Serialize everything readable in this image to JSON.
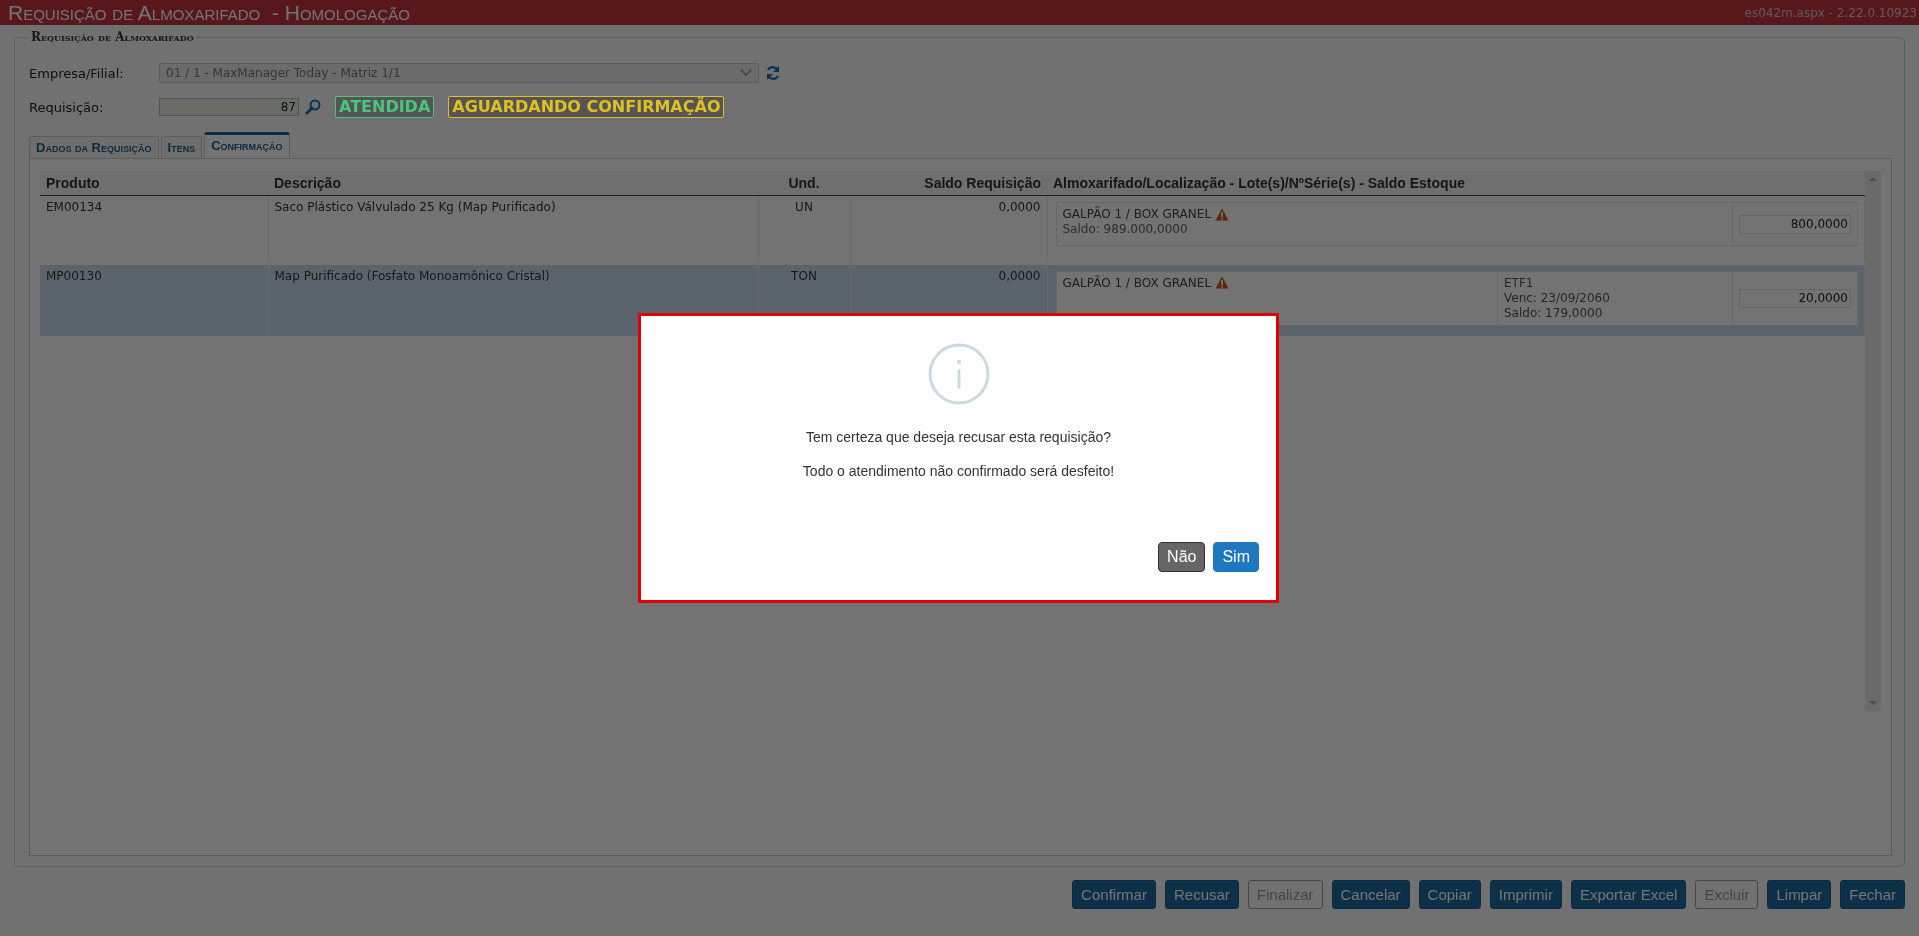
{
  "header": {
    "title": "Requisição de Almoxarifado  - Homologação",
    "version": "es042m.aspx - 2.22.0.10923"
  },
  "form": {
    "legend": "Requisição de Almoxarifado",
    "company_label": "Empresa/Filial:",
    "company_value": "01 / 1 - MaxManager Today - Matriz 1/1",
    "requisition_label": "Requisição:",
    "requisition_value": "87",
    "statuses": [
      {
        "text": "ATENDIDA",
        "color": "#4cc47f"
      },
      {
        "text": "AGUARDANDO CONFIRMAÇÃO",
        "color": "#e0c020"
      }
    ]
  },
  "tabs": [
    {
      "label": "Dados da Requisição",
      "selected": false
    },
    {
      "label": "Itens",
      "selected": false
    },
    {
      "label": "Confirmação",
      "selected": true
    }
  ],
  "table": {
    "columns": [
      "Produto",
      "Descrição",
      "Und.",
      "Saldo Requisição",
      "Almoxarifado/Localização - Lote(s)/NºSérie(s) - Saldo Estoque"
    ],
    "rows": [
      {
        "product": "EM00134",
        "description": "Saco Plástico Válvulado 25 Kg (Map Purificado)",
        "unit": "UN",
        "balance": "0,0000",
        "selected": false,
        "locations": [
          {
            "place": "GALPÃO 1 / BOX GRANEL",
            "warning": true,
            "balance": "Saldo: 989.000,0000",
            "quantity": "800,0000"
          }
        ]
      },
      {
        "product": "MP00130",
        "description": "Map Purificado (Fosfato Monoamônico Cristal)",
        "unit": "TON",
        "balance": "0,0000",
        "selected": true,
        "locations": [
          {
            "place": "GALPÃO 1 / BOX GRANEL",
            "warning": true,
            "lot": [
              "ETF1",
              "Venc: 23/09/2060",
              "Saldo: 179,0000"
            ],
            "quantity": "20,0000"
          }
        ]
      }
    ]
  },
  "dialog": {
    "message": "Tem certeza que deseja recusar esta requisição?",
    "note": "Todo o atendimento não confirmado será desfeito!",
    "buttons": [
      {
        "label": "Não",
        "kind": "secondary"
      },
      {
        "label": "Sim",
        "kind": "primary"
      }
    ]
  },
  "buttons": [
    {
      "label": "Confirmar",
      "disabled": false
    },
    {
      "label": "Recusar",
      "disabled": false
    },
    {
      "label": "Finalizar",
      "disabled": true
    },
    {
      "label": "Cancelar",
      "disabled": false
    },
    {
      "label": "Copiar",
      "disabled": false
    },
    {
      "label": "Imprimir",
      "disabled": false
    },
    {
      "label": "Exportar Excel",
      "disabled": false
    },
    {
      "label": "Excluir",
      "disabled": true
    },
    {
      "label": "Limpar",
      "disabled": false
    },
    {
      "label": "Fechar",
      "disabled": false
    }
  ]
}
